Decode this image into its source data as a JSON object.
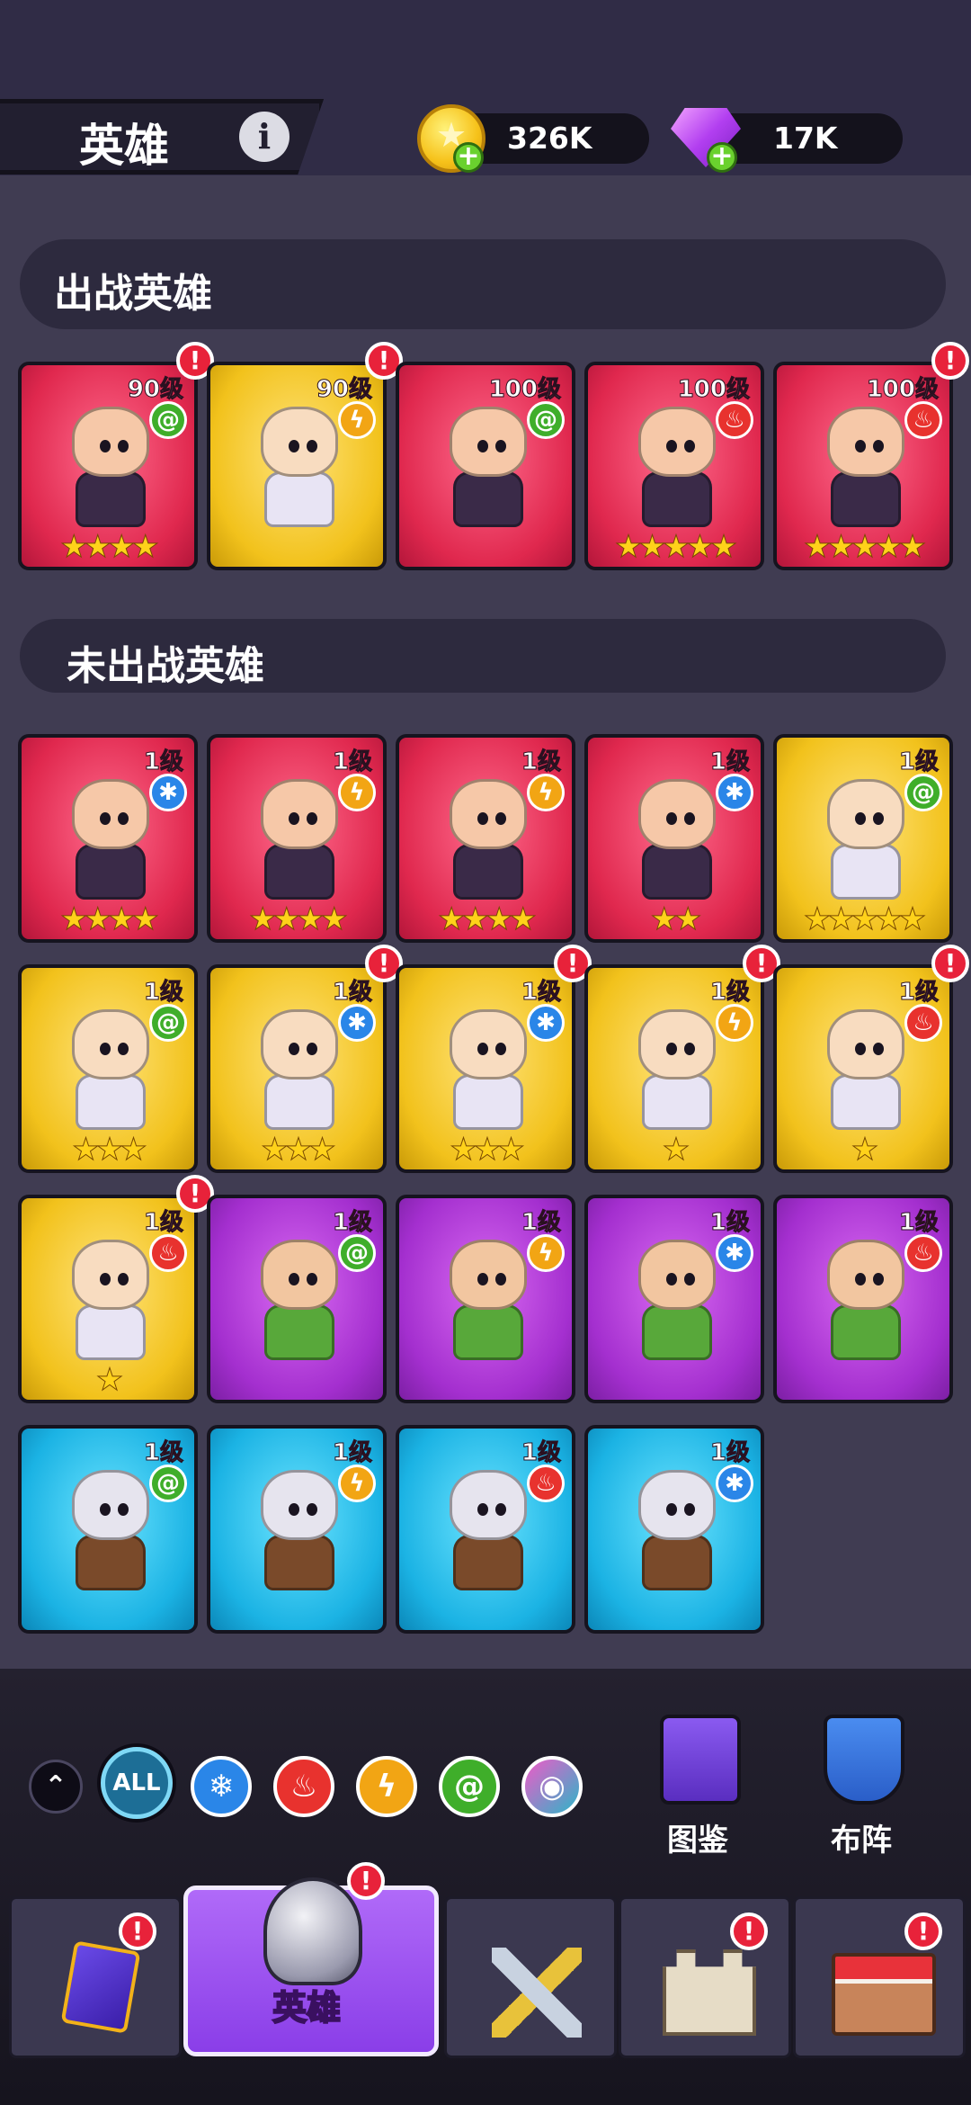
{
  "header": {
    "title": "英雄",
    "info_icon": "info-icon",
    "coins": "326K",
    "gems": "17K",
    "plus_symbol": "+"
  },
  "sections": {
    "deployed_title": "出战英雄",
    "undeployed_title": "未出战英雄"
  },
  "deployed_heroes": [
    {
      "level": "90级",
      "element": "wind",
      "stars": 4,
      "color": "red",
      "alert": true
    },
    {
      "level": "90级",
      "element": "light",
      "stars": 0,
      "color": "yellow",
      "alert": true
    },
    {
      "level": "100级",
      "element": "wind",
      "stars": 0,
      "color": "red",
      "alert": false
    },
    {
      "level": "100级",
      "element": "fire",
      "stars": 5,
      "color": "red",
      "alert": false
    },
    {
      "level": "100级",
      "element": "fire",
      "stars": 5,
      "color": "red",
      "alert": true
    }
  ],
  "undeployed_heroes": [
    {
      "level": "1级",
      "element": "ice",
      "stars": 4,
      "color": "red",
      "alert": false
    },
    {
      "level": "1级",
      "element": "light",
      "stars": 4,
      "color": "red",
      "alert": false
    },
    {
      "level": "1级",
      "element": "light",
      "stars": 4,
      "color": "red",
      "alert": false
    },
    {
      "level": "1级",
      "element": "ice",
      "stars": 2,
      "color": "red",
      "alert": false
    },
    {
      "level": "1级",
      "element": "wind",
      "stars": 5,
      "color": "yellow",
      "alert": false
    },
    {
      "level": "1级",
      "element": "wind",
      "stars": 3,
      "color": "yellow",
      "alert": false
    },
    {
      "level": "1级",
      "element": "ice",
      "stars": 3,
      "color": "yellow",
      "alert": true
    },
    {
      "level": "1级",
      "element": "ice",
      "stars": 3,
      "color": "yellow",
      "alert": true
    },
    {
      "level": "1级",
      "element": "light",
      "stars": 1,
      "color": "yellow",
      "alert": true
    },
    {
      "level": "1级",
      "element": "fire",
      "stars": 1,
      "color": "yellow",
      "alert": true
    },
    {
      "level": "1级",
      "element": "fire",
      "stars": 1,
      "color": "yellow",
      "alert": true
    },
    {
      "level": "1级",
      "element": "wind",
      "stars": 0,
      "color": "purple",
      "alert": false
    },
    {
      "level": "1级",
      "element": "light",
      "stars": 0,
      "color": "purple",
      "alert": false
    },
    {
      "level": "1级",
      "element": "ice",
      "stars": 0,
      "color": "purple",
      "alert": false
    },
    {
      "level": "1级",
      "element": "fire",
      "stars": 0,
      "color": "purple",
      "alert": false
    },
    {
      "level": "1级",
      "element": "wind",
      "stars": 0,
      "color": "blue",
      "alert": false
    },
    {
      "level": "1级",
      "element": "light",
      "stars": 0,
      "color": "blue",
      "alert": false
    },
    {
      "level": "1级",
      "element": "fire",
      "stars": 0,
      "color": "blue",
      "alert": false
    },
    {
      "level": "1级",
      "element": "ice",
      "stars": 0,
      "color": "blue",
      "alert": false
    }
  ],
  "filters": {
    "collapse": "collapse-icon",
    "all_label": "ALL",
    "elements": [
      {
        "name": "ice",
        "icon": "snowflake-icon",
        "color": "#2a86e8"
      },
      {
        "name": "fire",
        "icon": "flame-icon",
        "color": "#e8322e"
      },
      {
        "name": "light",
        "icon": "lightning-icon",
        "color": "#f2a514"
      },
      {
        "name": "wind",
        "icon": "tornado-icon",
        "color": "#3fae2a"
      },
      {
        "name": "eye",
        "icon": "eye-icon",
        "color": "#2bb6c8"
      }
    ]
  },
  "side_buttons": {
    "codex_label": "图鉴",
    "formation_label": "布阵"
  },
  "bottom_nav": {
    "active_label": "英雄",
    "alert_symbol": "!"
  },
  "element_glyphs": {
    "wind": "@",
    "light": "ϟ",
    "fire": "♨",
    "ice": "✱"
  },
  "colors": {
    "red_card": "#e0284e",
    "yellow_card": "#f2c21c",
    "purple_card": "#a42fcf",
    "blue_card": "#1bb3e4",
    "alert": "#e8223a"
  }
}
